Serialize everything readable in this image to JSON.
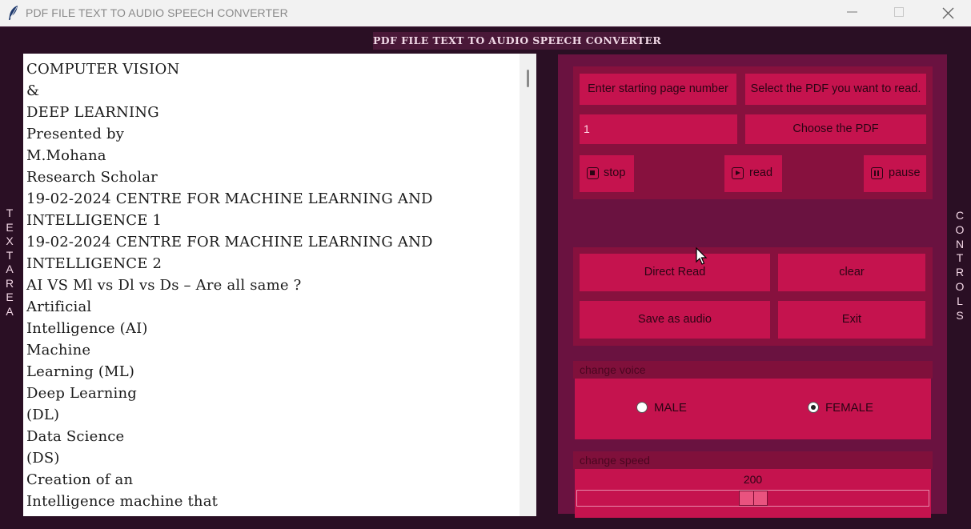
{
  "window": {
    "title": "PDF FILE TEXT TO AUDIO SPEECH CONVERTER"
  },
  "app": {
    "header": "PDF FILE TEXT TO AUDIO SPEECH CONVERTER",
    "left_label": [
      "T",
      "E",
      "X",
      "T",
      "A",
      "R",
      "E",
      "A"
    ],
    "right_label": [
      "C",
      "O",
      "N",
      "T",
      "R",
      "O",
      "L",
      "S"
    ]
  },
  "textarea": {
    "lines": [
      "COMPUTER VISION",
      "&",
      "DEEP LEARNING",
      "Presented by",
      "M.Mohana",
      "Research Scholar",
      "19-02-2024 CENTRE FOR MACHINE LEARNING AND",
      "INTELLIGENCE 1",
      "19-02-2024 CENTRE FOR MACHINE LEARNING AND",
      "INTELLIGENCE 2",
      "AI  VS  Ml  vs  Dl  vs  Ds – Are all same ?",
      "Artificial",
      "Intelligence (AI)",
      "Machine",
      "Learning (ML)",
      "Deep Learning",
      "(DL)",
      "Data Science",
      "(DS)",
      "Creation of an",
      "Intelligence machine that"
    ]
  },
  "controls": {
    "start_page_label": "Enter starting page number",
    "select_pdf_label": "Select the PDF you want to read.",
    "start_page_value": "1",
    "choose_pdf": "Choose  the PDF",
    "stop": "stop",
    "read": "read",
    "pause": "pause",
    "direct_read": "Direct Read",
    "clear": "clear",
    "save_audio": "Save as audio",
    "exit": "Exit",
    "voice": {
      "legend": "change voice",
      "male": "MALE",
      "female": "FEMALE",
      "selected": "FEMALE"
    },
    "speed": {
      "legend": "change speed",
      "value": "200",
      "fraction": 0.5
    }
  }
}
